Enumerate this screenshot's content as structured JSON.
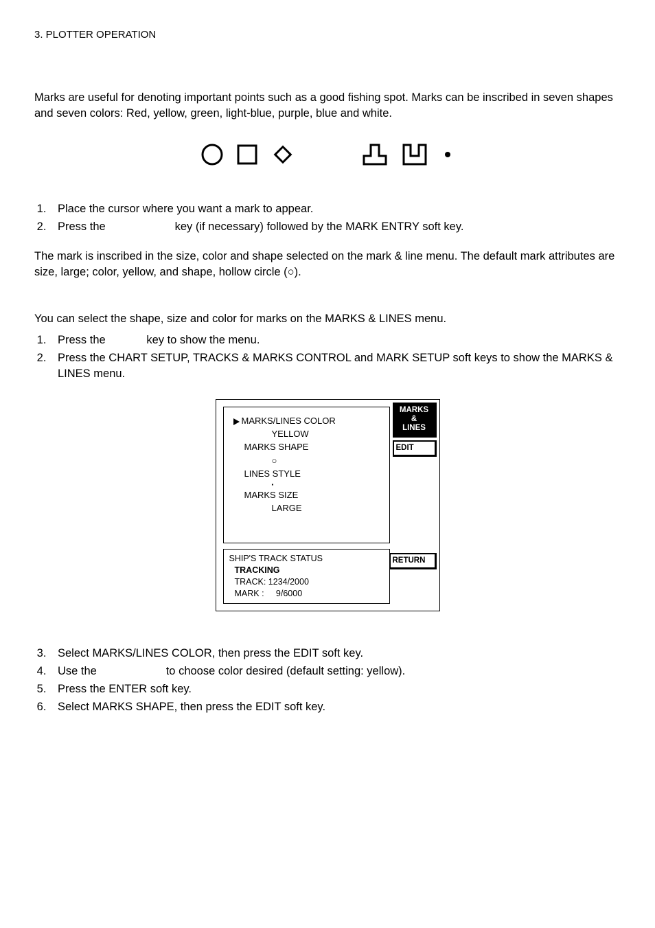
{
  "header": "3. PLOTTER OPERATION",
  "intro": "Marks are useful for denoting important points such as a good fishing spot. Marks can be inscribed in seven shapes and seven colors: Red, yellow, green, light-blue, purple, blue and white.",
  "steps_a": {
    "s1": "Place the cursor where you want a mark to appear.",
    "s2a": "Press the ",
    "s2b": " key (if necessary) followed by the MARK ENTRY soft key."
  },
  "after_a": "The mark is inscribed in the size, color and shape selected on the mark & line menu. The default mark attributes are size, large; color, yellow, and shape, hollow circle (○).",
  "section_b_intro": "You can select the shape, size and color for marks on the MARKS & LINES menu.",
  "steps_b": {
    "s1a": "Press the ",
    "s1b": " key to show the menu.",
    "s2": "Press the CHART SETUP, TRACKS & MARKS CONTROL and MARK SETUP soft keys to show the MARKS & LINES menu."
  },
  "menu": {
    "title_key1": "MARKS &",
    "title_key2": "LINES",
    "edit_key": "EDIT",
    "return_key": "RETURN",
    "row1": "MARKS/LINES COLOR",
    "val1": "YELLOW",
    "row2": "MARKS SHAPE",
    "val2": "○",
    "row3": "LINES STYLE",
    "val3": "▪",
    "row4": "MARKS SIZE",
    "val4": "LARGE",
    "status_title": "SHIP'S TRACK STATUS",
    "status_mode": "TRACKING",
    "status_track": "TRACK: 1234/2000",
    "status_mark": "MARK :     9/6000"
  },
  "steps_c": {
    "s3": "Select MARKS/LINES COLOR, then press the EDIT soft key.",
    "s4a": "Use the ",
    "s4b": " to choose color desired (default setting: yellow).",
    "s5": "Press the ENTER soft key.",
    "s6": "Select MARKS SHAPE, then press the EDIT soft key."
  }
}
